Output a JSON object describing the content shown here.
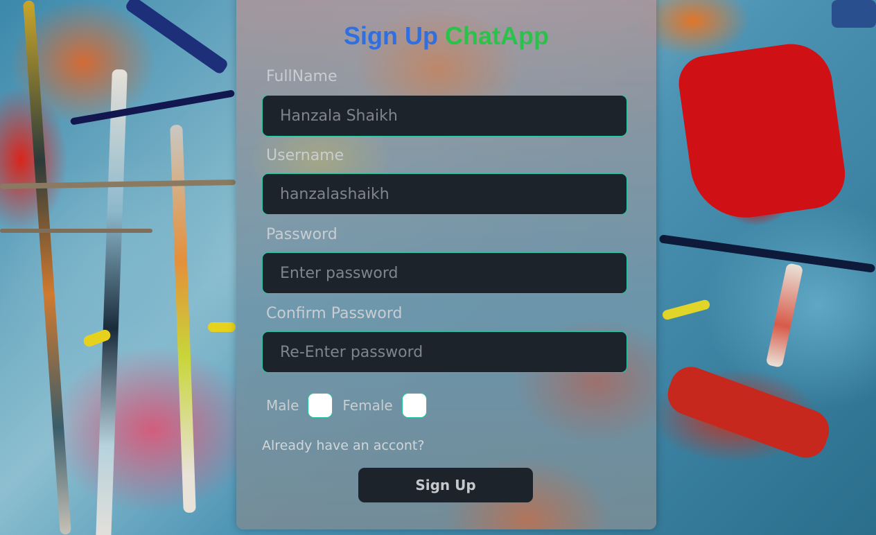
{
  "title": {
    "part1": "Sign Up",
    "part2": "ChatApp"
  },
  "fields": {
    "fullname": {
      "label": "FullName",
      "placeholder": "Hanzala Shaikh"
    },
    "username": {
      "label": "Username",
      "placeholder": "hanzalashaikh"
    },
    "password": {
      "label": "Password",
      "placeholder": "Enter password"
    },
    "confirm": {
      "label": "Confirm Password",
      "placeholder": "Re-Enter password"
    }
  },
  "gender": {
    "male": "Male",
    "female": "Female"
  },
  "login_link": "Already have an accont?",
  "submit_label": "Sign Up",
  "colors": {
    "title_primary": "#2f6fe0",
    "title_accent": "#2bc24c",
    "input_border": "#25c8a3",
    "input_bg": "#1d232a"
  }
}
